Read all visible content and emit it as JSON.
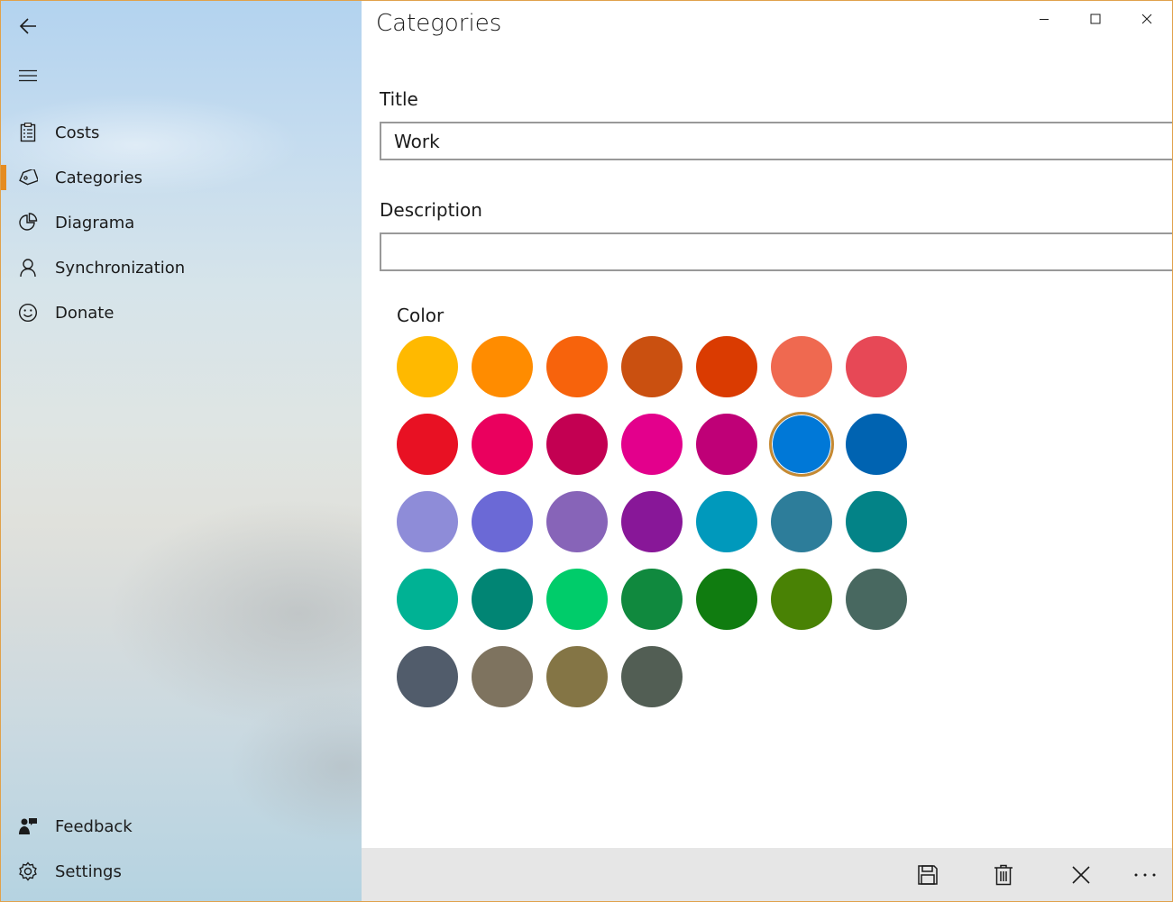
{
  "window": {
    "accent_color": "#e58c22"
  },
  "sidebar": {
    "back_icon": "back-arrow-icon",
    "menu_icon": "hamburger-menu-icon",
    "items": [
      {
        "label": "Costs",
        "icon": "clipboard-list-icon",
        "active": false
      },
      {
        "label": "Categories",
        "icon": "tag-icon",
        "active": true
      },
      {
        "label": "Diagrama",
        "icon": "pie-chart-icon",
        "active": false
      },
      {
        "label": "Synchronization",
        "icon": "person-icon",
        "active": false
      },
      {
        "label": "Donate",
        "icon": "smiley-icon",
        "active": false
      }
    ],
    "footer_items": [
      {
        "label": "Feedback",
        "icon": "feedback-icon"
      },
      {
        "label": "Settings",
        "icon": "gear-icon"
      }
    ]
  },
  "header": {
    "title": "Categories"
  },
  "form": {
    "title_label": "Title",
    "title_value": "Work",
    "description_label": "Description",
    "description_value": "",
    "color_label": "Color",
    "selected_color": "#0078d7",
    "colors": [
      "#ffb900",
      "#ff8c00",
      "#f7630c",
      "#ca5010",
      "#da3b01",
      "#ef6950",
      "#e74856",
      "#e81123",
      "#ea005e",
      "#c30052",
      "#e3008c",
      "#bf0077",
      "#0078d7",
      "#0063b1",
      "#8e8cd8",
      "#6b69d6",
      "#8764b8",
      "#881798",
      "#0099bc",
      "#2d7d9a",
      "#038387",
      "#00b294",
      "#018574",
      "#00cc6a",
      "#10893e",
      "#107c10",
      "#498205",
      "#486860",
      "#515c6b",
      "#7e735f",
      "#847545",
      "#525e54"
    ]
  },
  "commands": [
    {
      "name": "save",
      "icon": "save-icon"
    },
    {
      "name": "delete",
      "icon": "trash-icon"
    },
    {
      "name": "cancel",
      "icon": "close-icon"
    },
    {
      "name": "more",
      "icon": "more-icon"
    }
  ]
}
